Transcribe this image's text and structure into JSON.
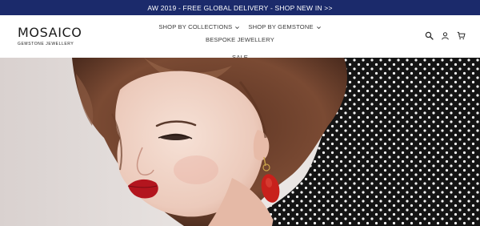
{
  "announcement": {
    "text": "AW 2019 - FREE GLOBAL DELIVERY - SHOP NEW IN >>"
  },
  "logo": {
    "title": "MOSAICO",
    "subtitle": "GEMSTONE JEWELLERY"
  },
  "nav": {
    "items": [
      {
        "label": "SHOP BY COLLECTIONS",
        "has_dropdown": true
      },
      {
        "label": "SHOP BY GEMSTONE",
        "has_dropdown": true
      },
      {
        "label": "BESPOKE JEWELLERY",
        "has_dropdown": false
      },
      {
        "label": "SALE",
        "has_dropdown": false
      }
    ]
  },
  "header_icons": [
    "search-icon",
    "account-icon",
    "cart-icon"
  ],
  "colors": {
    "announcement_bg": "#1b2a6b",
    "announcement_text": "#ffffff",
    "nav_text": "#3b3b3b",
    "hero_background": "#e7e3e1",
    "hero_hair": "#6b3f2a",
    "hero_skin": "#f1d6c9",
    "hero_lips": "#b3151e",
    "hero_earring": "#c8211c",
    "hero_dress": "#141414"
  }
}
